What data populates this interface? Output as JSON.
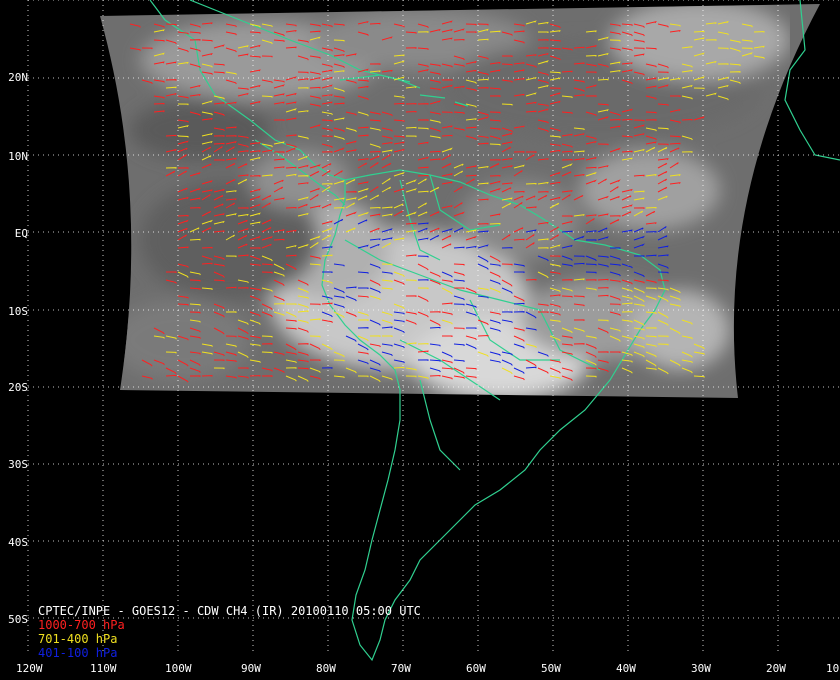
{
  "map": {
    "title": "CPTEC/INPE - GOES12 - CDW CH4 (IR) 20100110 05:00 UTC",
    "latitude_labels": [
      "20N",
      "10N",
      "EQ",
      "10S",
      "20S",
      "30S",
      "40S",
      "50S"
    ],
    "longitude_labels": [
      "120W",
      "110W",
      "100W",
      "90W",
      "80W",
      "70W",
      "60W",
      "50W",
      "40W",
      "30W",
      "20W",
      "10"
    ],
    "legend": [
      {
        "label": "1000-700 hPa",
        "color": "#ff2020"
      },
      {
        "label": "701-400 hPa",
        "color": "#f0e020"
      },
      {
        "label": "401-100 hPa",
        "color": "#1020e0"
      }
    ],
    "colors": {
      "background": "#000000",
      "coastline": "#30d090",
      "grid": "#ffffff",
      "imagery": "#7a7a7a"
    }
  }
}
